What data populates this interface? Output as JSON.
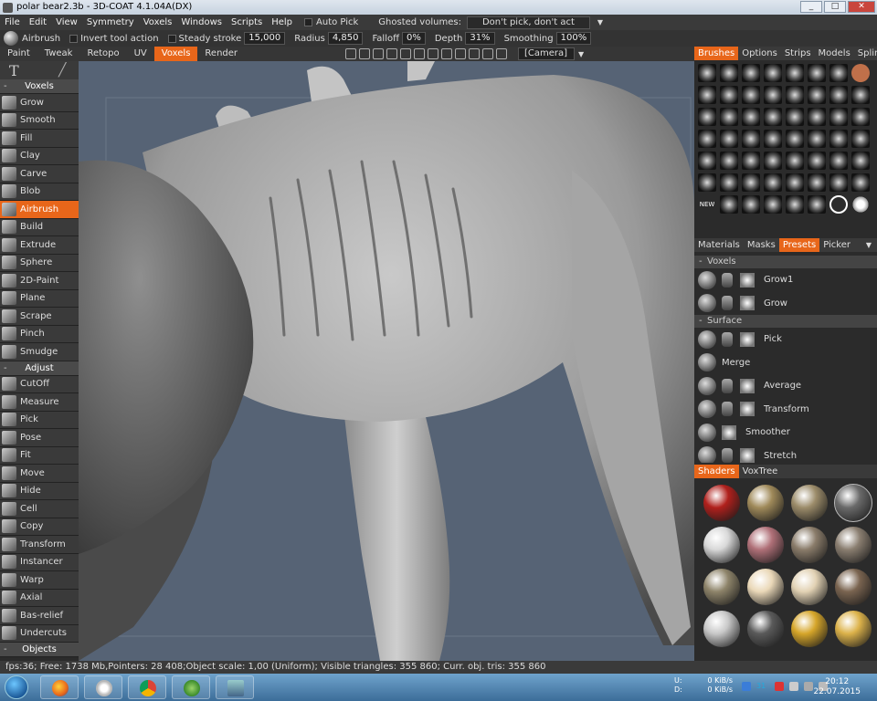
{
  "window": {
    "title": "polar bear2.3b - 3D-COAT 4.1.04A(DX)",
    "min_label": "_",
    "max_label": "□",
    "close_label": "✕"
  },
  "menu": [
    "File",
    "Edit",
    "View",
    "Symmetry",
    "Voxels",
    "Windows",
    "Scripts",
    "Help"
  ],
  "menu_options": {
    "auto_pick": "Auto Pick",
    "ghosted_label": "Ghosted volumes:",
    "ghosted_value": "Don't pick, don't act"
  },
  "tool_options": {
    "tool_name": "Airbrush",
    "invert_label": "Invert tool action",
    "steady_label": "Steady stroke",
    "steady_value": "15,000",
    "radius_label": "Radius",
    "radius_value": "4,850",
    "falloff_label": "Falloff",
    "falloff_value": "0%",
    "depth_label": "Depth",
    "depth_value": "31%",
    "smoothing_label": "Smoothing",
    "smoothing_value": "100%"
  },
  "modes": {
    "tabs": [
      "Paint",
      "Tweak",
      "Retopo",
      "UV",
      "Voxels",
      "Render"
    ],
    "active": "Voxels",
    "camera": "[Camera]"
  },
  "left_toolbar": {
    "header_icon": "T",
    "sections": [
      {
        "title": "Voxels",
        "tools": [
          "Grow",
          "Smooth",
          "Fill",
          "Clay",
          "Carve",
          "Blob",
          "Airbrush",
          "Build",
          "Extrude",
          "Sphere",
          "2D-Paint",
          "Plane",
          "Scrape",
          "Pinch",
          "Smudge"
        ]
      },
      {
        "title": "Adjust",
        "tools": [
          "CutOff",
          "Measure",
          "Pick",
          "Pose",
          "Fit",
          "Move",
          "Hide",
          "Cell",
          "Copy",
          "Transform",
          "Instancer",
          "Warp",
          "Axial",
          "Bas-relief",
          "Undercuts"
        ]
      },
      {
        "title": "Objects",
        "tools": []
      }
    ],
    "active_tool": "Airbrush"
  },
  "brushes_panel": {
    "tabs": [
      "Brushes",
      "Options",
      "Strips",
      "Models",
      "Splines"
    ],
    "active": "Brushes",
    "new_label": "NEW"
  },
  "presets_panel": {
    "tabs": [
      "Materials",
      "Masks",
      "Presets",
      "Picker"
    ],
    "active": "Presets",
    "groups": [
      {
        "title": "Voxels",
        "items": [
          "Grow1",
          "Grow"
        ]
      },
      {
        "title": "Surface",
        "items": [
          "Pick",
          "Merge",
          "Average",
          "Transform",
          "Smoother",
          "Stretch"
        ]
      }
    ]
  },
  "shaders_panel": {
    "tabs": [
      "Shaders",
      "VoxTree"
    ],
    "active": "Shaders",
    "shader_colors": [
      "#b0201c",
      "#a08a5a",
      "#9c8c6a",
      "#6a6a6a",
      "#d8d8d8",
      "#b07078",
      "#8a7c6a",
      "#8a7e70",
      "#8e846a",
      "#ead8b8",
      "#e2d2b4",
      "#7a6450",
      "#c8c8c8",
      "#5a5a5a",
      "#d6a62a",
      "#dcb24a"
    ]
  },
  "status": "fps:36;    Free: 1738 Mb,Pointers: 28 408;Object scale: 1,00 (Uniform); Visible triangles: 355 860; Curr. obj. tris: 355 860",
  "taskbar": {
    "up_label": "U:",
    "down_label": "D:",
    "up_rate": "0 KiB/s",
    "down_rate": "0 KiB/s",
    "tray_number": "31",
    "time": "20:12",
    "date": "22.07.2015",
    "apps": [
      "firefox-icon",
      "hat-icon",
      "chrome-icon",
      "3dcoat-icon",
      "screenshot-icon"
    ]
  }
}
